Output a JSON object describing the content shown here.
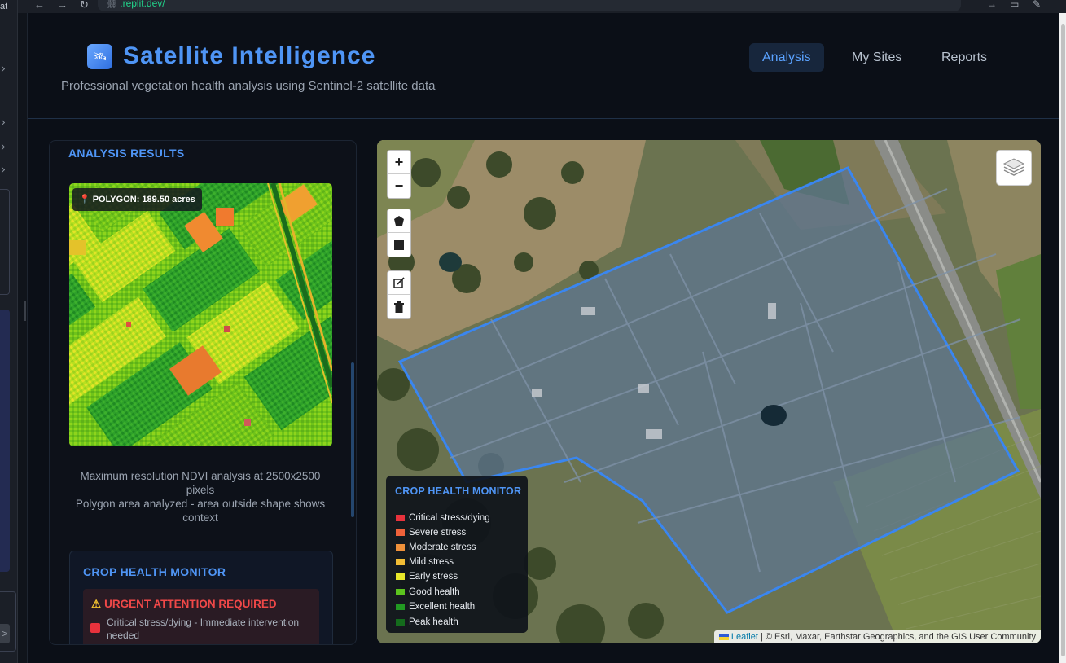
{
  "browser": {
    "url": ".replit.dev/",
    "dock_stub": "at",
    "dock_go": ">"
  },
  "header": {
    "title": "Satellite Intelligence",
    "subtitle": "Professional vegetation health analysis using Sentinel-2 satellite data",
    "nav": [
      {
        "label": "Analysis",
        "active": true
      },
      {
        "label": "My Sites",
        "active": false
      },
      {
        "label": "Reports",
        "active": false
      }
    ]
  },
  "results": {
    "title": "ANALYSIS RESULTS",
    "badge": "POLYGON: 189.50 acres",
    "caption_line1": "Maximum resolution NDVI analysis at 2500x2500 pixels",
    "caption_line2": "Polygon area analyzed - area outside shape shows context"
  },
  "health_card": {
    "title": "CROP HEALTH MONITOR",
    "urgent_title": "URGENT ATTENTION REQUIRED",
    "urgent_item": "Critical stress/dying - Immediate intervention needed"
  },
  "map": {
    "zoom_in": "+",
    "zoom_out": "−",
    "legend_title": "CROP HEALTH MONITOR",
    "legend": [
      {
        "label": "Critical stress/dying",
        "color": "#e8323c"
      },
      {
        "label": "Severe stress",
        "color": "#f0623a"
      },
      {
        "label": "Moderate stress",
        "color": "#f0913a"
      },
      {
        "label": "Mild stress",
        "color": "#f2bd35"
      },
      {
        "label": "Early stress",
        "color": "#e8e82a"
      },
      {
        "label": "Good health",
        "color": "#5cc41e"
      },
      {
        "label": "Excellent health",
        "color": "#229a22"
      },
      {
        "label": "Peak health",
        "color": "#146c1c"
      }
    ],
    "attribution_link": "Leaflet",
    "attribution_text": "| © Esri, Maxar, Earthstar Geographics, and the GIS User Community"
  },
  "colors": {
    "accent": "#4f95f5",
    "urgent": "#f04848",
    "polygon": "#3a86f0"
  }
}
